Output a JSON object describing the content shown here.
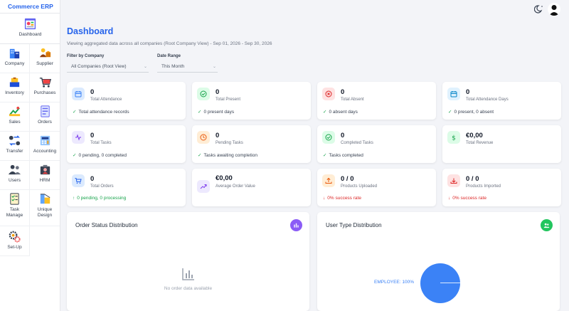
{
  "app": {
    "brand": "Commerce ERP"
  },
  "sidebar": {
    "dashboard_label": "Dashboard",
    "items": [
      {
        "label": "Company"
      },
      {
        "label": "Supplier"
      },
      {
        "label": "Inventory"
      },
      {
        "label": "Purchases"
      },
      {
        "label": "Sales"
      },
      {
        "label": "Orders"
      },
      {
        "label": "Transfer"
      },
      {
        "label": "Accounting"
      },
      {
        "label": "Users"
      },
      {
        "label": "HRM"
      },
      {
        "label": "Task Manage"
      },
      {
        "label": "Unique Design"
      },
      {
        "label": "Set-Up"
      }
    ]
  },
  "header": {
    "title": "Dashboard",
    "subtitle": "Viewing aggregated data across all companies (Root Company View) - Sep 01, 2026 - Sep 30, 2026"
  },
  "filters": {
    "company_label": "Filter by Company",
    "company_value": "All Companies (Root View)",
    "range_label": "Date Range",
    "range_value": "This Month"
  },
  "cards": {
    "total_attendance": {
      "value": "0",
      "label": "Total Attendance",
      "footer": "Total attendance records"
    },
    "total_present": {
      "value": "0",
      "label": "Total Present",
      "footer": "0 present days"
    },
    "total_absent": {
      "value": "0",
      "label": "Total Absent",
      "footer": "0 absent days"
    },
    "total_attendance_days": {
      "value": "0",
      "label": "Total Attendance Days",
      "footer": "0 present, 0 absent"
    },
    "total_tasks": {
      "value": "0",
      "label": "Total Tasks",
      "footer": "0 pending, 0 completed"
    },
    "pending_tasks": {
      "value": "0",
      "label": "Pending Tasks",
      "footer": "Tasks awaiting completion"
    },
    "completed_tasks": {
      "value": "0",
      "label": "Completed Tasks",
      "footer": "Tasks completed"
    },
    "total_revenue": {
      "value": "€0,00",
      "label": "Total Revenue"
    },
    "total_orders": {
      "value": "0",
      "label": "Total Orders",
      "footer": "0 pending, 0 processing"
    },
    "avg_order_value": {
      "value": "€0,00",
      "label": "Average Order Value"
    },
    "products_uploaded": {
      "value": "0 / 0",
      "label": "Products Uploaded",
      "footer": "0% success rate"
    },
    "products_imported": {
      "value": "0 / 0",
      "label": "Products Imported",
      "footer": "0% success rate"
    }
  },
  "panels": {
    "order_status": {
      "title": "Order Status Distribution",
      "empty_text": "No order data available"
    },
    "user_type": {
      "title": "User Type Distribution",
      "slice_label": "EMPLOYEE: 100%"
    }
  },
  "colors": {
    "accent": "#2563eb",
    "purple": "#8b5cf6",
    "green": "#22c55e",
    "pie": "#3b82f6"
  }
}
